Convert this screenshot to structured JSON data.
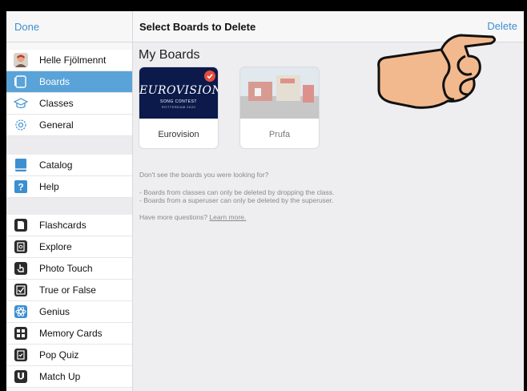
{
  "sidebar": {
    "done_label": "Done",
    "user_name": "Helle Fjölmennt",
    "nav": [
      {
        "label": "Boards",
        "icon": "boards-icon",
        "selected": true
      },
      {
        "label": "Classes",
        "icon": "classes-icon"
      },
      {
        "label": "General",
        "icon": "gear-icon"
      }
    ],
    "resources": [
      {
        "label": "Catalog",
        "icon": "book-icon"
      },
      {
        "label": "Help",
        "icon": "help-icon"
      }
    ],
    "games": [
      {
        "label": "Flashcards",
        "icon": "flashcards-icon"
      },
      {
        "label": "Explore",
        "icon": "explore-icon"
      },
      {
        "label": "Photo Touch",
        "icon": "hand-icon"
      },
      {
        "label": "True or False",
        "icon": "checkbox-icon"
      },
      {
        "label": "Genius",
        "icon": "atom-icon"
      },
      {
        "label": "Memory Cards",
        "icon": "memory-cards-icon"
      },
      {
        "label": "Pop Quiz",
        "icon": "pop-quiz-icon"
      },
      {
        "label": "Match Up",
        "icon": "match-up-icon"
      }
    ]
  },
  "header": {
    "title": "Select Boards to Delete",
    "delete_label": "Delete"
  },
  "main": {
    "section_title": "My Boards",
    "boards": [
      {
        "label": "Eurovision",
        "selected": true,
        "logo_text": "EUROVISION",
        "logo_sub": "SONG CONTEST",
        "logo_sub2": "ROTTERDAM 2020"
      },
      {
        "label": "Prufa",
        "selected": false
      }
    ],
    "info": {
      "question": "Don't see the boards you were looking for?",
      "line1": "- Boards from classes can only be deleted by dropping the class.",
      "line2": "- Boards from a superuser can only be deleted by the superuser.",
      "more_prefix": "Have more questions?",
      "learn_more": "Learn more."
    }
  },
  "colors": {
    "accent": "#3d8fd0",
    "selected_row": "#5aa3d8",
    "check_badge": "#e74c3c"
  }
}
